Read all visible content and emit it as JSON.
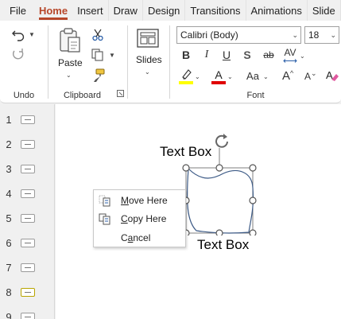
{
  "tabs": [
    "File",
    "Home",
    "Insert",
    "Draw",
    "Design",
    "Transitions",
    "Animations",
    "Slide"
  ],
  "ribbon": {
    "undo_group_label": "Undo",
    "paste_label": "Paste",
    "clipboard_group_label": "Clipboard",
    "slides_label": "Slides",
    "font_name": "Calibri (Body)",
    "font_size": "18",
    "font_group_label": "Font",
    "format_buttons": {
      "bold": "B",
      "italic": "I",
      "underline": "U",
      "shadow": "S",
      "strike": "ab",
      "spacing": "AV",
      "change_case": "Aa",
      "increase": "A",
      "decrease": "A"
    }
  },
  "thumbnails": [
    "1",
    "2",
    "3",
    "4",
    "5",
    "6",
    "7",
    "8",
    "9"
  ],
  "canvas": {
    "text_box_top": "Text Box",
    "text_box_bottom": "Text Box"
  },
  "context_menu": {
    "move_here": {
      "before": "",
      "key": "M",
      "after": "ove Here"
    },
    "copy_here": {
      "before": "",
      "key": "C",
      "after": "opy Here"
    },
    "cancel": {
      "before": "C",
      "key": "a",
      "after": "ncel"
    }
  },
  "colors": {
    "accent": "#b7472a",
    "highlight": "#ffff00",
    "font_color": "#e00000",
    "curve": "#3c5a86"
  }
}
